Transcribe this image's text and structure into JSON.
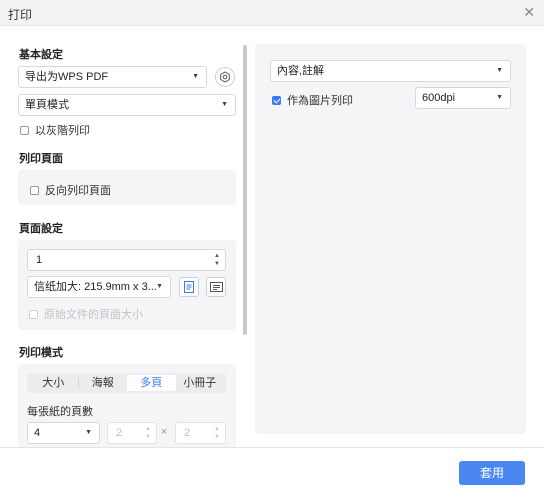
{
  "window": {
    "title": "打印"
  },
  "basic": {
    "title": "基本設定",
    "printer": "导出为WPS PDF",
    "mode": "單頁模式",
    "grayscale": "以灰階列印"
  },
  "print_pages": {
    "title": "列印頁面",
    "reverse": "反向列印頁面"
  },
  "page_setup": {
    "title": "頁面設定",
    "copies": "1",
    "paper": "信纸加大: 215.9mm x 3...",
    "original_size": "原始文件的頁面大小"
  },
  "print_mode": {
    "title": "列印模式",
    "tabs": [
      {
        "label": "大小",
        "active": false
      },
      {
        "label": "海報",
        "active": false
      },
      {
        "label": "多頁",
        "active": true
      },
      {
        "label": "小冊子",
        "active": false
      }
    ],
    "pages_per_sheet_label": "每張紙的頁數",
    "pages_per_sheet": "4",
    "cols": "2",
    "rows": "2",
    "times": "×"
  },
  "right": {
    "content": "內容,註解",
    "print_as_image": "作為圖片列印",
    "dpi": "600dpi"
  },
  "footer": {
    "apply": "套用"
  },
  "colors": {
    "accent": "#3b7cf0",
    "button": "#4a86f0",
    "panel": "#f5f5f7"
  }
}
